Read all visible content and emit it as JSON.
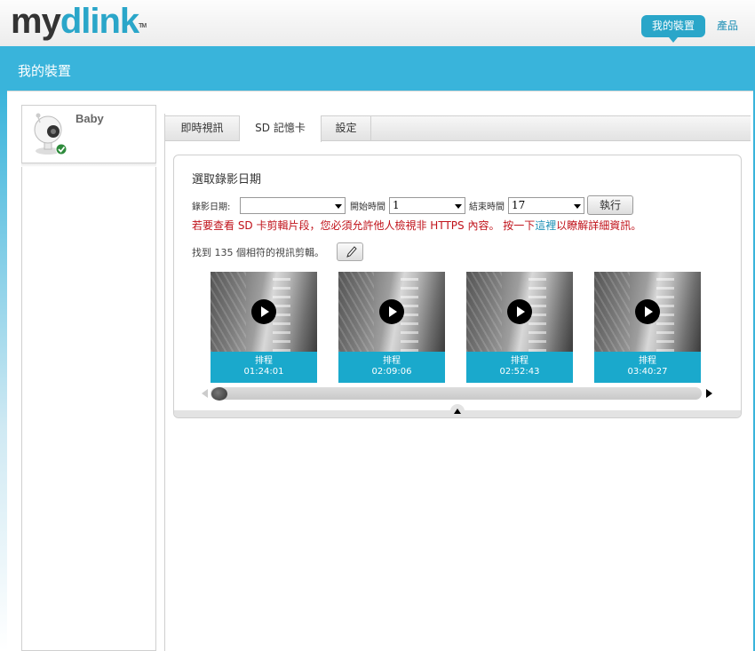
{
  "header": {
    "logo_main": "my",
    "logo_accent": "dlink",
    "logo_tm": "TM",
    "nav_my_devices": "我的裝置",
    "nav_products": "產品"
  },
  "band": {
    "title": "我的裝置"
  },
  "device": {
    "name": "Baby",
    "status": "online"
  },
  "tabs": [
    {
      "label": "即時視訊"
    },
    {
      "label": "SD 記憶卡"
    },
    {
      "label": "設定"
    }
  ],
  "sd": {
    "section_title": "選取錄影日期",
    "date_label": "錄影日期:",
    "date_value": "",
    "start_label": "開始時間",
    "start_value": "1",
    "end_label": "結束時間",
    "end_value": "17",
    "run_button": "執行",
    "warning_pre": "若要查看 SD 卡剪輯片段，您必須允許他人檢視非 HTTPS 內容。 按一下",
    "warning_link": "這裡",
    "warning_post": "以瞭解詳細資訊。",
    "found_text": "找到  135 個相符的視訊剪輯。",
    "clips": [
      {
        "type": "排程",
        "time": "01:24:01"
      },
      {
        "type": "排程",
        "time": "02:09:06"
      },
      {
        "type": "排程",
        "time": "02:52:43"
      },
      {
        "type": "排程",
        "time": "03:40:27"
      }
    ]
  },
  "colors": {
    "accent": "#39b4db",
    "clip_caption": "#1aa9cc",
    "warning": "#c0121a"
  }
}
